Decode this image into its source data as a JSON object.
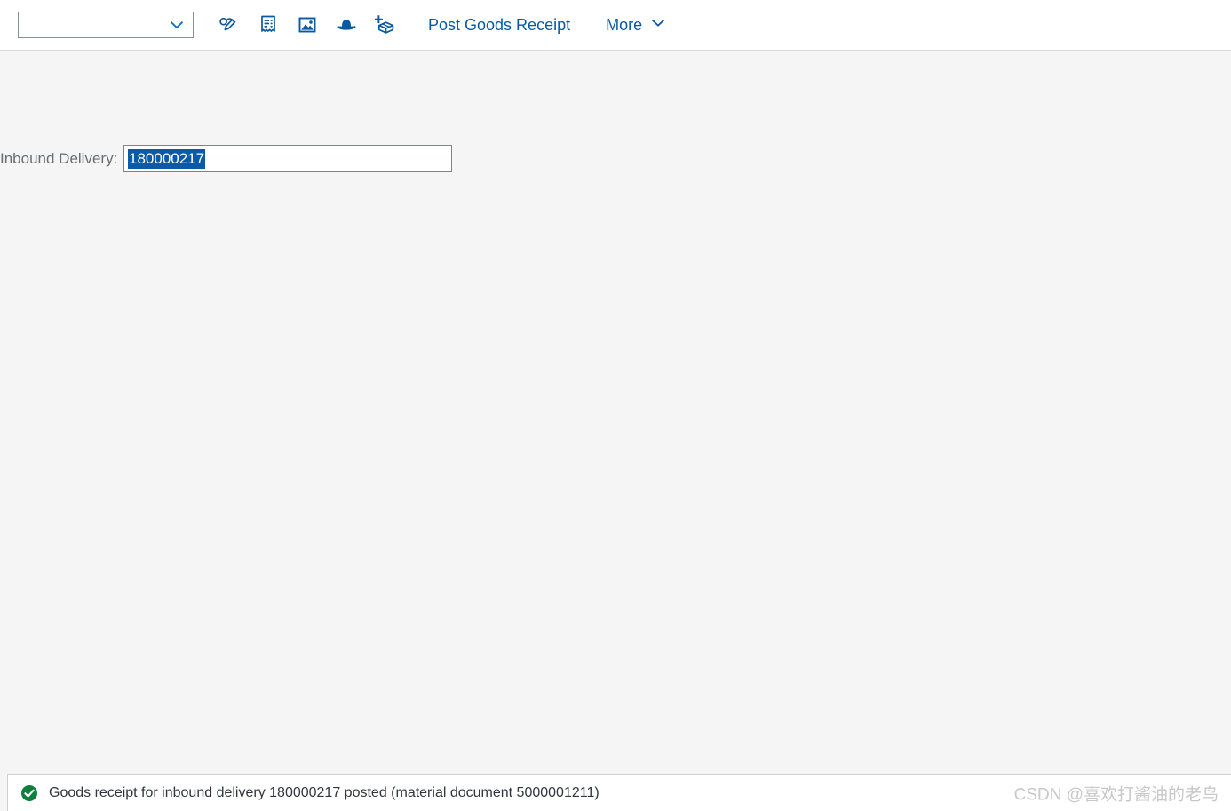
{
  "toolbar": {
    "variant_select": {
      "value": "",
      "placeholder": "",
      "icon": "chevron-down-icon"
    },
    "icon_buttons": [
      {
        "name": "display-change-icon",
        "tooltip": "Display/Change"
      },
      {
        "name": "document-receipt-icon",
        "tooltip": "Document"
      },
      {
        "name": "image-icon",
        "tooltip": "Attachment"
      },
      {
        "name": "hat-icon",
        "tooltip": "Personal Settings"
      },
      {
        "name": "add-package-icon",
        "tooltip": "Add Item"
      }
    ],
    "post_goods_receipt_label": "Post Goods Receipt",
    "more_label": "More",
    "more_icon": "chevron-down-icon"
  },
  "form": {
    "inbound_delivery": {
      "label": "Inbound Delivery:",
      "value": "180000217",
      "placeholder": "",
      "selected": true
    }
  },
  "message_bar": {
    "status_icon": "success-check-icon",
    "text": "Goods receipt for inbound delivery 180000217 posted (material document 5000001211)"
  },
  "watermark": {
    "text": "CSDN @喜欢打酱油的老鸟"
  },
  "colors": {
    "accent_blue": "#0a6ed1",
    "link_blue": "#0a5aa3",
    "selection_blue": "#0a5aa8",
    "success_green": "#107e3e",
    "label_gray": "#6a6d70",
    "text_dark": "#32363a",
    "page_bg": "#f5f5f5",
    "watermark_gray": "#c8c8c8"
  }
}
